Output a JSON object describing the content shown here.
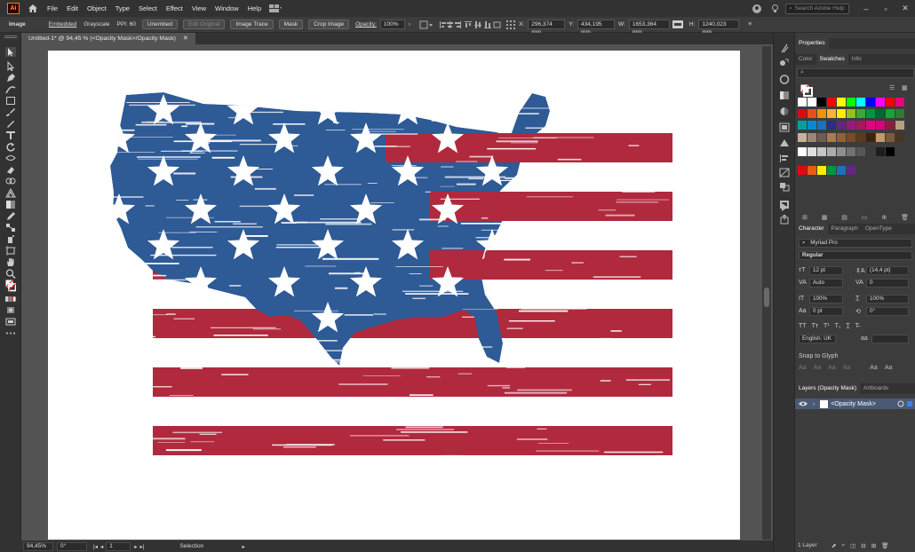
{
  "app": {
    "logo": "Ai",
    "menu": [
      "File",
      "Edit",
      "Object",
      "Type",
      "Select",
      "Effect",
      "View",
      "Window",
      "Help"
    ],
    "search_placeholder": "Search Adobe Help"
  },
  "control_bar": {
    "object_type": "Image",
    "embedded": "Embedded",
    "color_mode": "Grayscale",
    "ppi": "PPI: 60",
    "unembed": "Unembed",
    "edit_original": "Edit Original",
    "image_trace": "Image Trace",
    "mask": "Mask",
    "crop_image": "Crop Image",
    "opacity_label": "Opacity:",
    "opacity_value": "100%",
    "x_label": "X:",
    "x_value": "296,374 mm",
    "y_label": "Y:",
    "y_value": "434,195 mm",
    "w_label": "W:",
    "w_value": "1653,364 mm",
    "h_label": "H:",
    "h_value": "1240,023 mm"
  },
  "document": {
    "tab_title": "Untitled-1* @ 94,45 % (<Opacity Mask>/Opacity Mask)"
  },
  "status_bar": {
    "zoom": "94,45%",
    "rotation": "0°",
    "artboard_number": "1",
    "tool_name": "Selection"
  },
  "properties_panel": {
    "title": "Properties",
    "tabs": [
      "Color",
      "Swatches",
      "Info"
    ],
    "active_tab": "Swatches"
  },
  "swatches": {
    "rows": [
      [
        "#ffffff",
        "#ffffff",
        "#000000",
        "#ff0000",
        "#ffff00",
        "#00ff00",
        "#00ffff",
        "#0000ff",
        "#ff00ff",
        "#ff0000",
        "#e6007e"
      ],
      [
        "#e30613",
        "#e94e1b",
        "#f39200",
        "#f9b233",
        "#ffed00",
        "#95c11f",
        "#3aaa35",
        "#009640",
        "#006633",
        "#13a538",
        "#2d7c35"
      ],
      [
        "#00a19a",
        "#008bd2",
        "#1d71b8",
        "#2d2e83",
        "#662483",
        "#951b81",
        "#a3195b",
        "#e6007e",
        "#d6007e",
        "#8a1e41",
        "#b4a181"
      ],
      [
        "#c6b39a",
        "#9b8579",
        "#6d5c52",
        "#a87c4f",
        "#936037",
        "#7b4a26",
        "#5c3a1e",
        "#3b2313",
        "#c39a6b",
        "#7d5a3c",
        "#4a3520"
      ],
      [
        "#ffffff",
        "#e0e0e0",
        "#c6c6c6",
        "#ababab",
        "#8f8f8f",
        "#727272",
        "#575757",
        "#3c3c3c",
        "#1d1d1b",
        "#000000"
      ],
      [
        "#e30613",
        "#ea5b0c",
        "#ffed00",
        "#009640",
        "#1d71b8",
        "#662483"
      ]
    ]
  },
  "character_panel": {
    "tabs": [
      "Character",
      "Paragraph",
      "OpenType"
    ],
    "font_family": "Myriad Pro",
    "font_style": "Regular",
    "font_size": "12 pt",
    "leading": "(14,4 pt)",
    "kerning": "Auto",
    "tracking": "0",
    "vertical_scale": "100%",
    "horizontal_scale": "100%",
    "baseline_shift": "0 pt",
    "rotation": "0°",
    "language": "English: UK",
    "snap_to_glyph": "Snap to Glyph"
  },
  "layers_panel": {
    "tabs": [
      "Layers (Opacity Mask)",
      "Artboards"
    ],
    "layer_name": "<Opacity Mask>",
    "footer_count": "1 Layer"
  },
  "artwork": {
    "red": "#b0293d",
    "blue": "#2e5a96",
    "stripe_count": 7,
    "star_count": 46
  }
}
